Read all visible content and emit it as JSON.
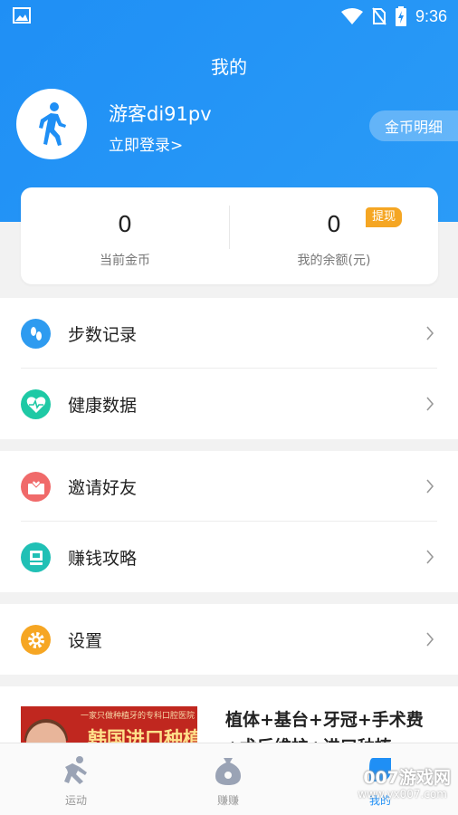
{
  "status_bar": {
    "time": "9:36",
    "icons": [
      "image-icon",
      "wifi-icon",
      "no-sim-icon",
      "battery-charging-icon"
    ]
  },
  "header": {
    "title": "我的",
    "username": "游客di91pv",
    "login_link": "立即登录>",
    "coin_detail_button": "金币明细",
    "avatar_icon": "walking-person-icon"
  },
  "stats": {
    "coins": {
      "value": "0",
      "label": "当前金币"
    },
    "balance": {
      "value": "0",
      "label": "我的余额(元)"
    },
    "withdraw_button": "提现"
  },
  "menu_groups": [
    [
      {
        "label": "步数记录",
        "icon": "footprints-icon",
        "color": "#2e9bf0"
      },
      {
        "label": "健康数据",
        "icon": "heart-pulse-icon",
        "color": "#1ec9a5"
      }
    ],
    [
      {
        "label": "邀请好友",
        "icon": "envelope-heart-icon",
        "color": "#f06a6a"
      },
      {
        "label": "赚钱攻略",
        "icon": "guide-book-icon",
        "color": "#20c0b5"
      }
    ],
    [
      {
        "label": "设置",
        "icon": "gear-icon",
        "color": "#f6a623"
      }
    ]
  ],
  "ad": {
    "image_top_text": "一家只做种植牙的专科口腔医院",
    "image_main_text": "韩国进口种植",
    "title": "植体+基台+牙冠+手术费+术后维护+进口种植"
  },
  "tabbar": {
    "tabs": [
      {
        "label": "运动",
        "icon": "running-icon",
        "active": false
      },
      {
        "label": "赚赚",
        "icon": "coin-bag-icon",
        "active": false
      },
      {
        "label": "我的",
        "icon": "profile-icon",
        "active": true
      }
    ]
  },
  "watermark": {
    "text": "007游戏网",
    "url": "www.yx007.com"
  },
  "colors": {
    "primary": "#1f8ff5",
    "withdraw": "#f5a623",
    "background": "#f2f2f2"
  }
}
